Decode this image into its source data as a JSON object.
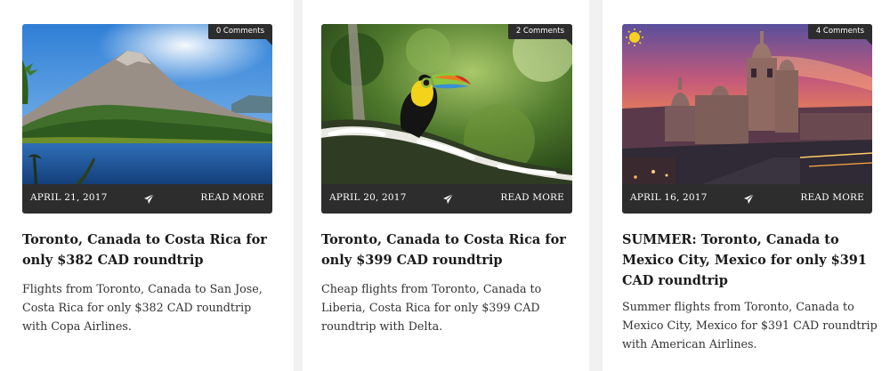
{
  "posts": [
    {
      "comments": "0 Comments",
      "date": "APRIL 21, 2017",
      "read_more": "READ MORE",
      "title": "Toronto, Canada to Costa Rica for only $382 CAD roundtrip",
      "excerpt": "Flights from Toronto, Canada to San Jose, Costa Rica for only $382 CAD roundtrip with Copa Airlines."
    },
    {
      "comments": "2 Comments",
      "date": "APRIL 20, 2017",
      "read_more": "READ MORE",
      "title": "Toronto, Canada to Costa Rica for only $399 CAD roundtrip",
      "excerpt": "Cheap flights from Toronto, Canada to Liberia, Costa Rica for only $399 CAD roundtrip with Delta."
    },
    {
      "comments": "4 Comments",
      "date": "APRIL 16, 2017",
      "read_more": "READ MORE",
      "title": "SUMMER: Toronto, Canada to Mexico City, Mexico for only $391 CAD roundtrip",
      "excerpt": "Summer flights from Toronto, Canada to Mexico City, Mexico for $391 CAD roundtrip with American Airlines."
    }
  ],
  "icons": {
    "share": "paper-plane-icon"
  },
  "colors": {
    "meta_bar": "#2d2d2d",
    "title": "#1a1a1a",
    "excerpt": "#333333"
  }
}
